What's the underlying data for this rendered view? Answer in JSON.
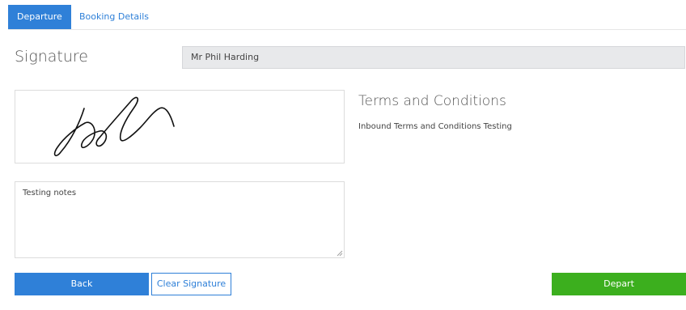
{
  "tabs": [
    {
      "label": "Departure",
      "active": true
    },
    {
      "label": "Booking Details",
      "active": false
    }
  ],
  "signature": {
    "heading": "Signature",
    "signer_name": "Mr Phil Harding"
  },
  "terms": {
    "heading": "Terms and Conditions",
    "text": "Inbound Terms and Conditions Testing"
  },
  "notes": {
    "value": "Testing notes"
  },
  "buttons": {
    "back": "Back",
    "clear_signature": "Clear Signature",
    "depart": "Depart"
  },
  "colors": {
    "primary": "#2f80d8",
    "success": "#3caf1e",
    "field_bg": "#e8e9eb"
  }
}
